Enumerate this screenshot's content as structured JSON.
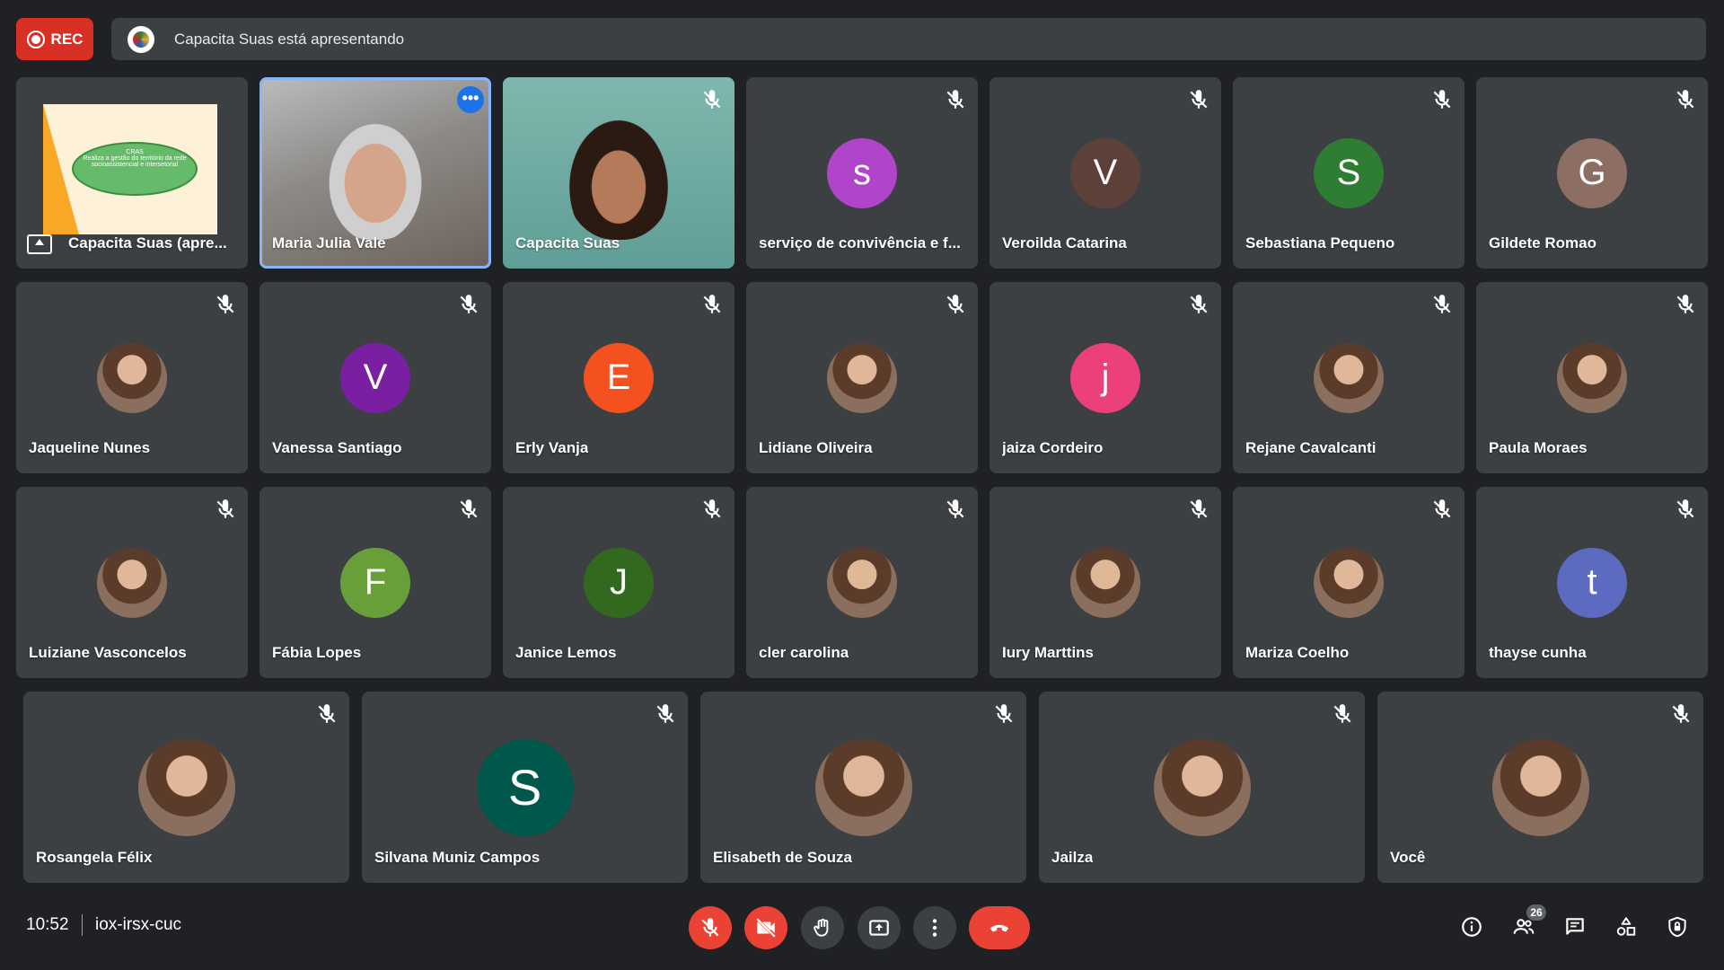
{
  "top_bar": {
    "rec_label": "REC",
    "presenting_text": "Capacita Suas está apresentando"
  },
  "slide": {
    "line1": "CRAS",
    "line2": "Realiza a gestão do território da rede socioassistencial e intersetorial"
  },
  "tiles": [
    {
      "name": "Capacita Suas (apre..."
    },
    {
      "name": "Maria Julia Vale"
    },
    {
      "name": "Capacita Suas"
    },
    {
      "name": "serviço de convivência e f...",
      "initial": "s",
      "color": "#b045c9"
    },
    {
      "name": "Veroilda Catarina",
      "initial": "V",
      "color": "#5d4037"
    },
    {
      "name": "Sebastiana Pequeno",
      "initial": "S",
      "color": "#2e7d32"
    },
    {
      "name": "Gildete Romao",
      "initial": "G",
      "color": "#8d6e63"
    },
    {
      "name": "Jaqueline Nunes"
    },
    {
      "name": "Vanessa Santiago",
      "initial": "V",
      "color": "#7b1fa2"
    },
    {
      "name": "Erly Vanja",
      "initial": "E",
      "color": "#f4511e"
    },
    {
      "name": "Lidiane Oliveira"
    },
    {
      "name": "jaiza Cordeiro",
      "initial": "j",
      "color": "#ec407a"
    },
    {
      "name": "Rejane Cavalcanti"
    },
    {
      "name": "Paula Moraes"
    },
    {
      "name": "Luiziane Vasconcelos"
    },
    {
      "name": "Fábia Lopes",
      "initial": "F",
      "color": "#689f38"
    },
    {
      "name": "Janice Lemos",
      "initial": "J",
      "color": "#33691e"
    },
    {
      "name": "cler carolina"
    },
    {
      "name": "Iury Marttins"
    },
    {
      "name": "Mariza Coelho"
    },
    {
      "name": "thayse cunha",
      "initial": "t",
      "color": "#5c6bc0"
    },
    {
      "name": "Rosangela Félix"
    },
    {
      "name": "Silvana Muniz Campos",
      "initial": "S",
      "color": "#00574b"
    },
    {
      "name": "Elisabeth de Souza"
    },
    {
      "name": "Jailza"
    },
    {
      "name": "Você"
    }
  ],
  "bottom_bar": {
    "time": "10:52",
    "meeting_code": "iox-irsx-cuc",
    "participant_count": "26"
  },
  "colors": {
    "background": "#202124",
    "tile": "#3c4043",
    "rec": "#d93025",
    "danger": "#ea4335",
    "accent": "#1a73e8"
  }
}
